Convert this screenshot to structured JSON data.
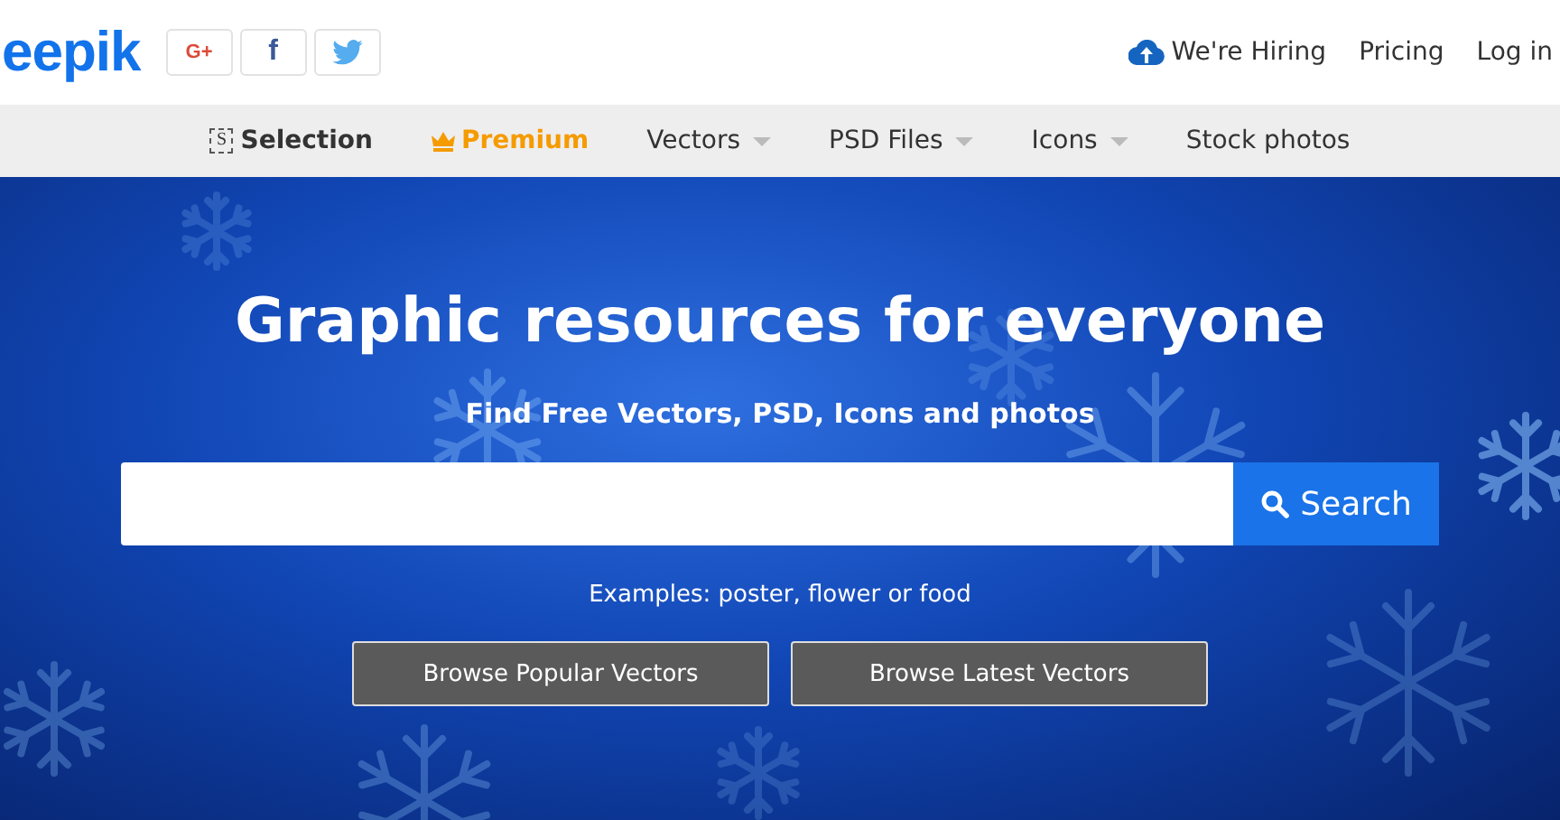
{
  "header": {
    "logo": "eepik",
    "social": [
      {
        "kind": "google",
        "label": "G+"
      },
      {
        "kind": "facebook",
        "label": "f"
      },
      {
        "kind": "twitter"
      }
    ],
    "links": [
      {
        "kind": "hiring",
        "label": "We're Hiring"
      },
      {
        "kind": "plain",
        "label": "Pricing"
      },
      {
        "kind": "plain",
        "label": "Log in"
      }
    ]
  },
  "nav": [
    {
      "kind": "selection",
      "label": "Selection",
      "icon_letter": "S"
    },
    {
      "kind": "premium",
      "label": "Premium"
    },
    {
      "kind": "dropdown",
      "label": "Vectors"
    },
    {
      "kind": "dropdown",
      "label": "PSD Files"
    },
    {
      "kind": "dropdown",
      "label": "Icons"
    },
    {
      "kind": "plain",
      "label": "Stock photos"
    }
  ],
  "hero": {
    "title": "Graphic resources for everyone",
    "subtitle": "Find Free Vectors, PSD, Icons and photos",
    "search": {
      "button": "Search"
    },
    "examples": "Examples: poster, flower or food",
    "buttons": [
      "Browse Popular Vectors",
      "Browse Latest Vectors"
    ]
  }
}
